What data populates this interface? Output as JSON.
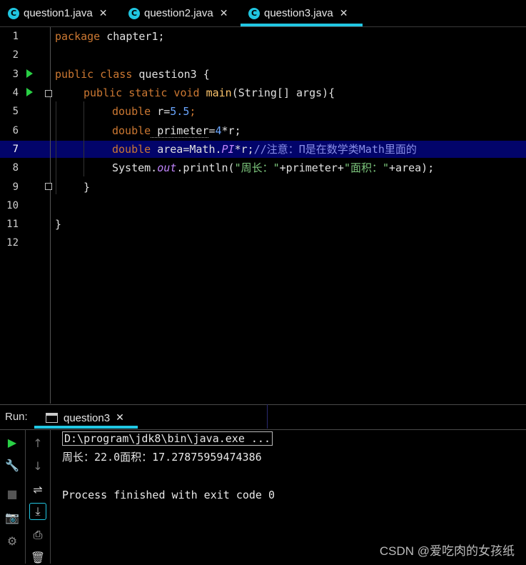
{
  "tabs": [
    {
      "label": "question1.java",
      "icon": "java-class-icon",
      "active": false
    },
    {
      "label": "question2.java",
      "icon": "java-class-icon",
      "active": false
    },
    {
      "label": "question3.java",
      "icon": "java-class-icon",
      "active": true
    }
  ],
  "editor": {
    "line_numbers": [
      "1",
      "2",
      "3",
      "4",
      "5",
      "6",
      "7",
      "8",
      "9",
      "10",
      "11",
      "12"
    ],
    "code": {
      "l1": {
        "kw": "package",
        "rest": " chapter1;"
      },
      "l3": {
        "kw": "public class",
        "rest": " question3 {"
      },
      "l4": {
        "kw": "public static void",
        "name": " main",
        "rest": "(String[] args){"
      },
      "l5": {
        "kw": "double",
        "var": " r=",
        "num": "5.5",
        "end": ";"
      },
      "l6": {
        "kw": "double",
        "var": " primeter",
        "eq": "=",
        "num": "4",
        "end": "*r;"
      },
      "l7": {
        "kw": "double",
        "var": " area=Math.",
        "const": "PI",
        "op": "*r;",
        "comment": "//注意：Π是在数学类Math里面的"
      },
      "l8": {
        "pre": "System.",
        "field": "out",
        "call": ".println(",
        "s1": "\"周长：\"",
        "mid": "+primeter+",
        "s2": "\"面积：\"",
        "end": "+area);"
      },
      "l9": "}",
      "l11": "}"
    }
  },
  "run": {
    "label": "Run:",
    "tab_label": "question3",
    "console": {
      "cmd": "D:\\program\\jdk8\\bin\\java.exe ...",
      "output": "周长：22.0面积：17.27875959474386",
      "exit": "Process finished with exit code 0"
    }
  },
  "watermark": "CSDN @爱吃肉的女孩纸",
  "colors": {
    "accent": "#21c7e3",
    "run_green": "#29d045",
    "keyword": "#cc7832",
    "highlight": "#02046a"
  }
}
